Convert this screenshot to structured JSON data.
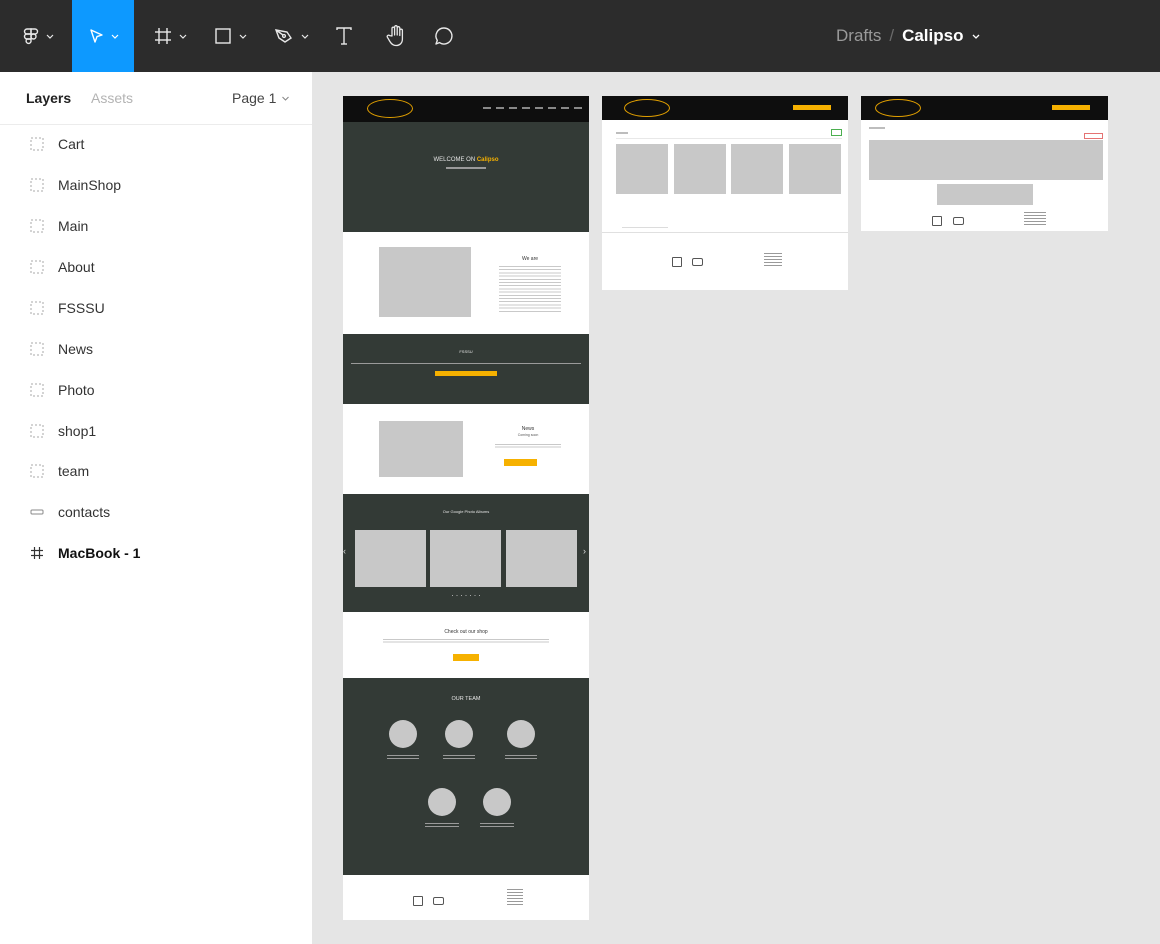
{
  "toolbar": {
    "tools": [
      {
        "icon": "figma-menu-icon"
      },
      {
        "icon": "move-tool-icon"
      },
      {
        "icon": "frame-tool-icon"
      },
      {
        "icon": "shape-tool-icon"
      },
      {
        "icon": "pen-tool-icon"
      },
      {
        "icon": "text-tool-icon"
      },
      {
        "icon": "hand-tool-icon"
      },
      {
        "icon": "comment-tool-icon"
      }
    ],
    "breadcrumb": {
      "folder": "Drafts",
      "separator": "/",
      "file": "Calipso"
    },
    "active_color": "#0d99ff"
  },
  "left_panel": {
    "tabs": {
      "layers": "Layers",
      "assets": "Assets"
    },
    "page_selector": "Page 1",
    "layers": [
      {
        "name": "Cart",
        "icon": "frame-dotted-icon"
      },
      {
        "name": "MainShop",
        "icon": "frame-dotted-icon"
      },
      {
        "name": "Main",
        "icon": "frame-dotted-icon"
      },
      {
        "name": "About",
        "icon": "frame-dotted-icon"
      },
      {
        "name": "FSSSU",
        "icon": "frame-dotted-icon"
      },
      {
        "name": "News",
        "icon": "frame-dotted-icon"
      },
      {
        "name": "Photo",
        "icon": "frame-dotted-icon"
      },
      {
        "name": "shop1",
        "icon": "frame-dotted-icon"
      },
      {
        "name": "team",
        "icon": "frame-dotted-icon"
      },
      {
        "name": "contacts",
        "icon": "rectangle-icon"
      },
      {
        "name": "MacBook - 1",
        "icon": "frame-hash-icon"
      }
    ]
  },
  "canvas": {
    "main_frame": {
      "hero_title": "WELCOME ON",
      "hero_brand": "Calipso",
      "about_title": "We are",
      "fsssu_title": "FSSSU",
      "news_title": "News",
      "news_subtitle": "Coming soon",
      "photo_title": "Our Google Photo Albums",
      "shop_title": "Check out our shop",
      "team_title": "OUR TEAM"
    },
    "colors": {
      "dark_section": "#333a36",
      "accent": "#f6b100",
      "placeholder": "#c8c8c8"
    }
  }
}
